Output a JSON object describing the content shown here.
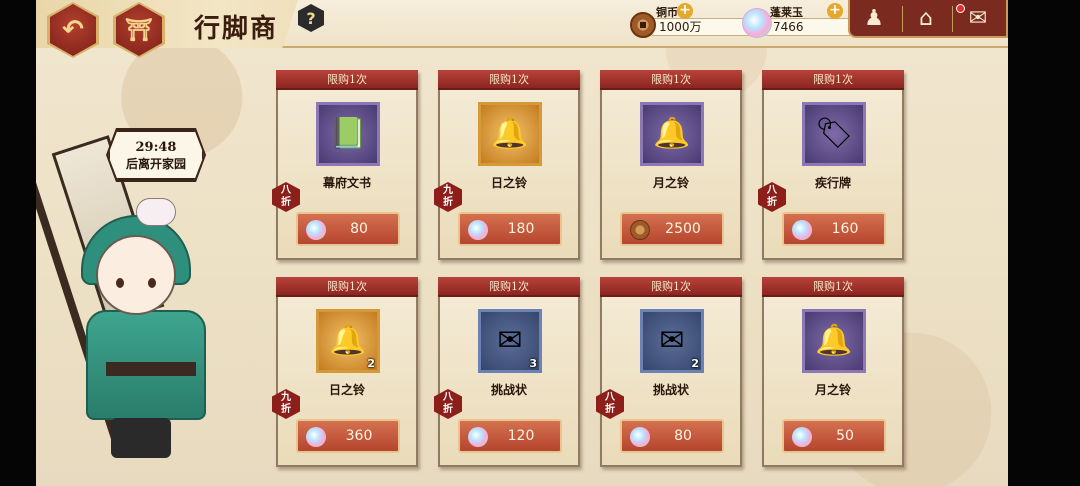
{
  "header": {
    "title": "行脚商",
    "help_glyph": "?",
    "back_glyph": "↶",
    "home_glyph": "⛩"
  },
  "currencies": [
    {
      "label": "铜币",
      "value": "1000万",
      "icon": "coin-icon",
      "plus": "+"
    },
    {
      "label": "蓬莱玉",
      "value": "7466",
      "icon": "jade-icon",
      "plus": "+"
    }
  ],
  "top_icons": [
    {
      "name": "character-icon",
      "glyph": "♟"
    },
    {
      "name": "home-icon",
      "glyph": "⌂"
    },
    {
      "name": "mail-icon",
      "glyph": "✉"
    }
  ],
  "merchant": {
    "timer": "29:48",
    "timer_caption": "后离开家园"
  },
  "shop": {
    "items": [
      {
        "limit": "限购1次",
        "name": "幕府文书",
        "icon": "book-icon",
        "glyph": "📗",
        "frame": "purple",
        "qty": "",
        "currency": "jade",
        "price": "80",
        "discount": "八\n折"
      },
      {
        "limit": "限购1次",
        "name": "日之铃",
        "icon": "gold-bell-icon",
        "glyph": "🔔",
        "frame": "gold",
        "qty": "",
        "currency": "jade",
        "price": "180",
        "discount": "九\n折"
      },
      {
        "limit": "限购1次",
        "name": "月之铃",
        "icon": "silver-bell-icon",
        "glyph": "🔔",
        "frame": "purple",
        "qty": "",
        "currency": "coin",
        "price": "2500",
        "discount": ""
      },
      {
        "limit": "限购1次",
        "name": "疾行牌",
        "icon": "tag-icon",
        "glyph": "🏷",
        "frame": "purple",
        "qty": "",
        "currency": "jade",
        "price": "160",
        "discount": "八\n折"
      },
      {
        "limit": "限购1次",
        "name": "日之铃",
        "icon": "gold-bell-icon",
        "glyph": "🔔",
        "frame": "gold",
        "qty": "2",
        "currency": "jade",
        "price": "360",
        "discount": "九\n折"
      },
      {
        "limit": "限购1次",
        "name": "挑战状",
        "icon": "letter-icon",
        "glyph": "✉",
        "frame": "blue",
        "qty": "3",
        "currency": "jade",
        "price": "120",
        "discount": "八\n折"
      },
      {
        "limit": "限购1次",
        "name": "挑战状",
        "icon": "letter-icon",
        "glyph": "✉",
        "frame": "blue",
        "qty": "2",
        "currency": "jade",
        "price": "80",
        "discount": "八\n折"
      },
      {
        "limit": "限购1次",
        "name": "月之铃",
        "icon": "silver-bell-icon",
        "glyph": "🔔",
        "frame": "purple",
        "qty": "",
        "currency": "jade",
        "price": "50",
        "discount": ""
      }
    ]
  }
}
